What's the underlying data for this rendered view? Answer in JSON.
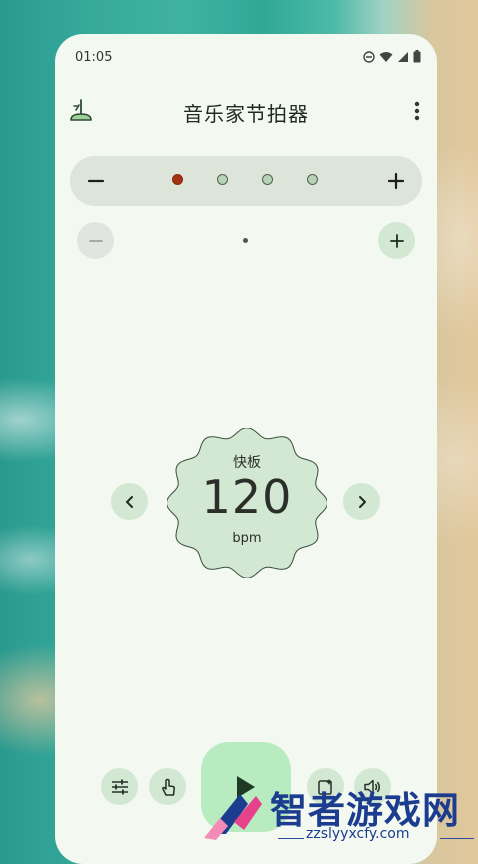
{
  "status_bar": {
    "time": "01:05"
  },
  "app_bar": {
    "title": "音乐家节拍器"
  },
  "beats": [
    {
      "accent": true
    },
    {
      "accent": false
    },
    {
      "accent": false
    },
    {
      "accent": false
    }
  ],
  "tempo": {
    "name": "快板",
    "value": "120",
    "unit": "bpm"
  },
  "watermark": {
    "title": "智者游戏网",
    "subtitle": "zzslyyxcfy.com"
  },
  "colors": {
    "accent_beat": "#a33313",
    "normal_beat": "#b7d3b6",
    "button_bg": "#d2e8d2",
    "play_bg": "#b8ecc0",
    "surface": "#f3f8f0"
  },
  "icons": {
    "app_logo": "metronome-icon",
    "menu": "more-vert-icon",
    "bottom": [
      "tune-icon",
      "tap-icon",
      "play-icon",
      "edit-note-icon",
      "volume-icon"
    ]
  }
}
